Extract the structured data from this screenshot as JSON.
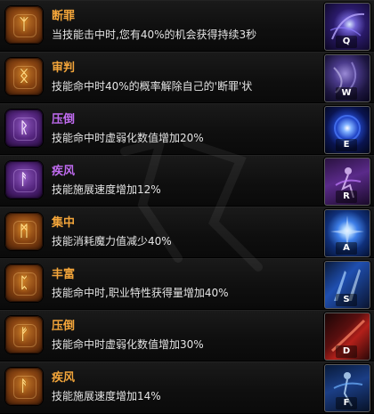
{
  "runes": [
    {
      "name": "断罪",
      "name_color": "orange",
      "rune_color": "orange",
      "glyph": "ᛉ",
      "description": "当技能击中时,您有40%的机会获得持续3秒",
      "skill_key": "Q",
      "skill_art": "dark-purple-swirl"
    },
    {
      "name": "审判",
      "name_color": "orange",
      "rune_color": "orange",
      "glyph": "ᛝ",
      "description": "技能命中时40%的概率解除自己的'断罪'状",
      "skill_key": "W",
      "skill_art": "dark-swirl"
    },
    {
      "name": "压倒",
      "name_color": "purple",
      "rune_color": "purple",
      "glyph": "ᚱ",
      "description": "技能命中时虚弱化数值增加20%",
      "skill_key": "E",
      "skill_art": "blue-orb"
    },
    {
      "name": "疾风",
      "name_color": "purple",
      "rune_color": "purple",
      "glyph": "ᚨ",
      "description": "技能施展速度增加12%",
      "skill_key": "R",
      "skill_art": "violet-figure"
    },
    {
      "name": "集中",
      "name_color": "orange",
      "rune_color": "orange",
      "glyph": "ᛗ",
      "description": "技能消耗魔力值减少40%",
      "skill_key": "A",
      "skill_art": "blue-burst"
    },
    {
      "name": "丰富",
      "name_color": "orange",
      "rune_color": "orange",
      "glyph": "ᛈ",
      "description": "技能命中时,职业特性获得量增加40%",
      "skill_key": "S",
      "skill_art": "blue-blades"
    },
    {
      "name": "压倒",
      "name_color": "orange",
      "rune_color": "orange",
      "glyph": "ᚠ",
      "description": "技能命中时虚弱化数值增加30%",
      "skill_key": "D",
      "skill_art": "red-slash"
    },
    {
      "name": "疾风",
      "name_color": "orange",
      "rune_color": "orange",
      "glyph": "ᚨ",
      "description": "技能施展速度增加14%",
      "skill_key": "F",
      "skill_art": "blue-figure"
    }
  ],
  "colors": {
    "orange_name": "#f3a53a",
    "purple_name": "#c06bf0",
    "description": "#e4e4e4"
  }
}
